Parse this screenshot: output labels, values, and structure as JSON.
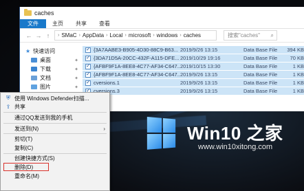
{
  "explorer": {
    "title": "caches",
    "ribbon_tabs": [
      "文件",
      "主页",
      "共享",
      "查看"
    ],
    "breadcrumb": [
      "SMaC",
      "AppData",
      "Local",
      "microsoft",
      "windows",
      "caches"
    ],
    "search_placeholder": "搜索\"caches\"",
    "nav_items": [
      {
        "label": "快速访问",
        "icon": "star-icon"
      },
      {
        "label": "桌面",
        "icon": "desktop-folder-icon"
      },
      {
        "label": "下载",
        "icon": "download-folder-icon"
      },
      {
        "label": "文档",
        "icon": "documents-folder-icon"
      },
      {
        "label": "图片",
        "icon": "pictures-folder-icon"
      }
    ],
    "files": [
      {
        "name": "{3A7AABE3-B905-4D30-88C9-B63...",
        "date": "2019/9/26 13:15",
        "type": "Data Base File",
        "size": "394 KB"
      },
      {
        "name": "{3DA71D5A-20CC-432F-A115-DFE...",
        "date": "2019/10/29 19:16",
        "type": "Data Base File",
        "size": "70 KB"
      },
      {
        "name": "{AFBF9F1A-8EE8-4C77-AF34-C647...",
        "date": "2019/10/15 13:30",
        "type": "Data Base File",
        "size": "1 KB"
      },
      {
        "name": "{AFBF9F1A-8EE8-4C77-AF34-C647...",
        "date": "2019/9/26 13:15",
        "type": "Data Base File",
        "size": "1 KB"
      },
      {
        "name": "cversions.1",
        "date": "2019/9/26 13:15",
        "type": "Data Base File",
        "size": "1 KB"
      },
      {
        "name": "cversions.3",
        "date": "2019/9/26 13:15",
        "type": "Data Base File",
        "size": "1 KB"
      }
    ]
  },
  "context_menu": {
    "items": [
      {
        "label": "使用 Windows Defender扫描...",
        "icon": "shield-icon"
      },
      {
        "label": "共享",
        "icon": "share-icon"
      },
      {
        "separator": true
      },
      {
        "label": "通过QQ发送到我的手机"
      },
      {
        "separator": true
      },
      {
        "label": "发送到(N)",
        "submenu": true
      },
      {
        "separator": true
      },
      {
        "label": "剪切(T)"
      },
      {
        "label": "复制(C)"
      },
      {
        "separator": true
      },
      {
        "label": "创建快捷方式(S)"
      },
      {
        "label": "删除(D)",
        "highlighted": true
      },
      {
        "label": "重命名(M)"
      }
    ]
  },
  "branding": {
    "name": "Win10 之家",
    "url": "www.win10xitong.com"
  }
}
